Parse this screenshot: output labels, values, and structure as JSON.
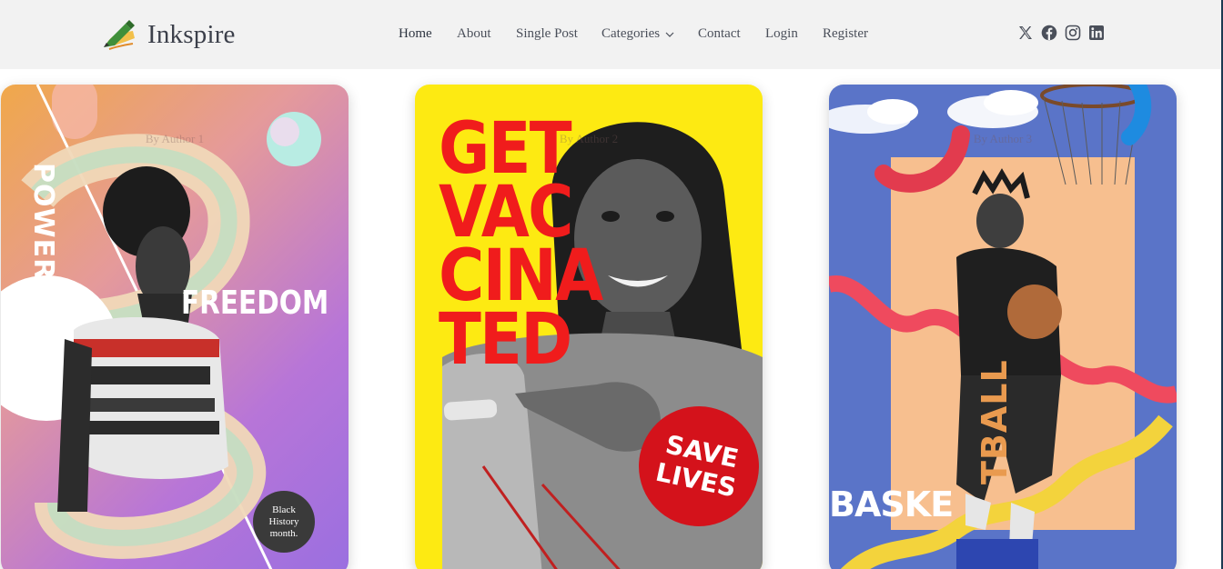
{
  "brand": {
    "name": "Inkspire",
    "logo_icon": "pencil-logo-icon"
  },
  "nav": {
    "items": [
      {
        "label": "Home",
        "active": true
      },
      {
        "label": "About"
      },
      {
        "label": "Single Post"
      },
      {
        "label": "Categories",
        "has_dropdown": true
      },
      {
        "label": "Contact"
      },
      {
        "label": "Login"
      },
      {
        "label": "Register"
      }
    ]
  },
  "social": [
    {
      "icon": "x-twitter-icon"
    },
    {
      "icon": "facebook-icon"
    },
    {
      "icon": "instagram-icon"
    },
    {
      "icon": "linkedin-icon"
    }
  ],
  "cards": [
    {
      "author": "By Author 1",
      "poster": {
        "word1": "POWER",
        "word2": "FREEDOM",
        "badge": [
          "Black",
          "History",
          "month."
        ]
      }
    },
    {
      "author": "By Author 2",
      "poster": {
        "headline": [
          "GET",
          "VAC",
          "CINA",
          "TED"
        ],
        "badge": [
          "SAVE",
          "LIVES"
        ]
      }
    },
    {
      "author": "By Author 3",
      "poster": {
        "word1": "BASKE",
        "word2": "TBALL"
      }
    }
  ],
  "colors": {
    "nav_bg": "#f2f2f2",
    "text": "#4a4f5a",
    "card2_bg": "#fdea12",
    "card2_accent": "#f01c1c",
    "card3_bg": "#5a74c8"
  }
}
